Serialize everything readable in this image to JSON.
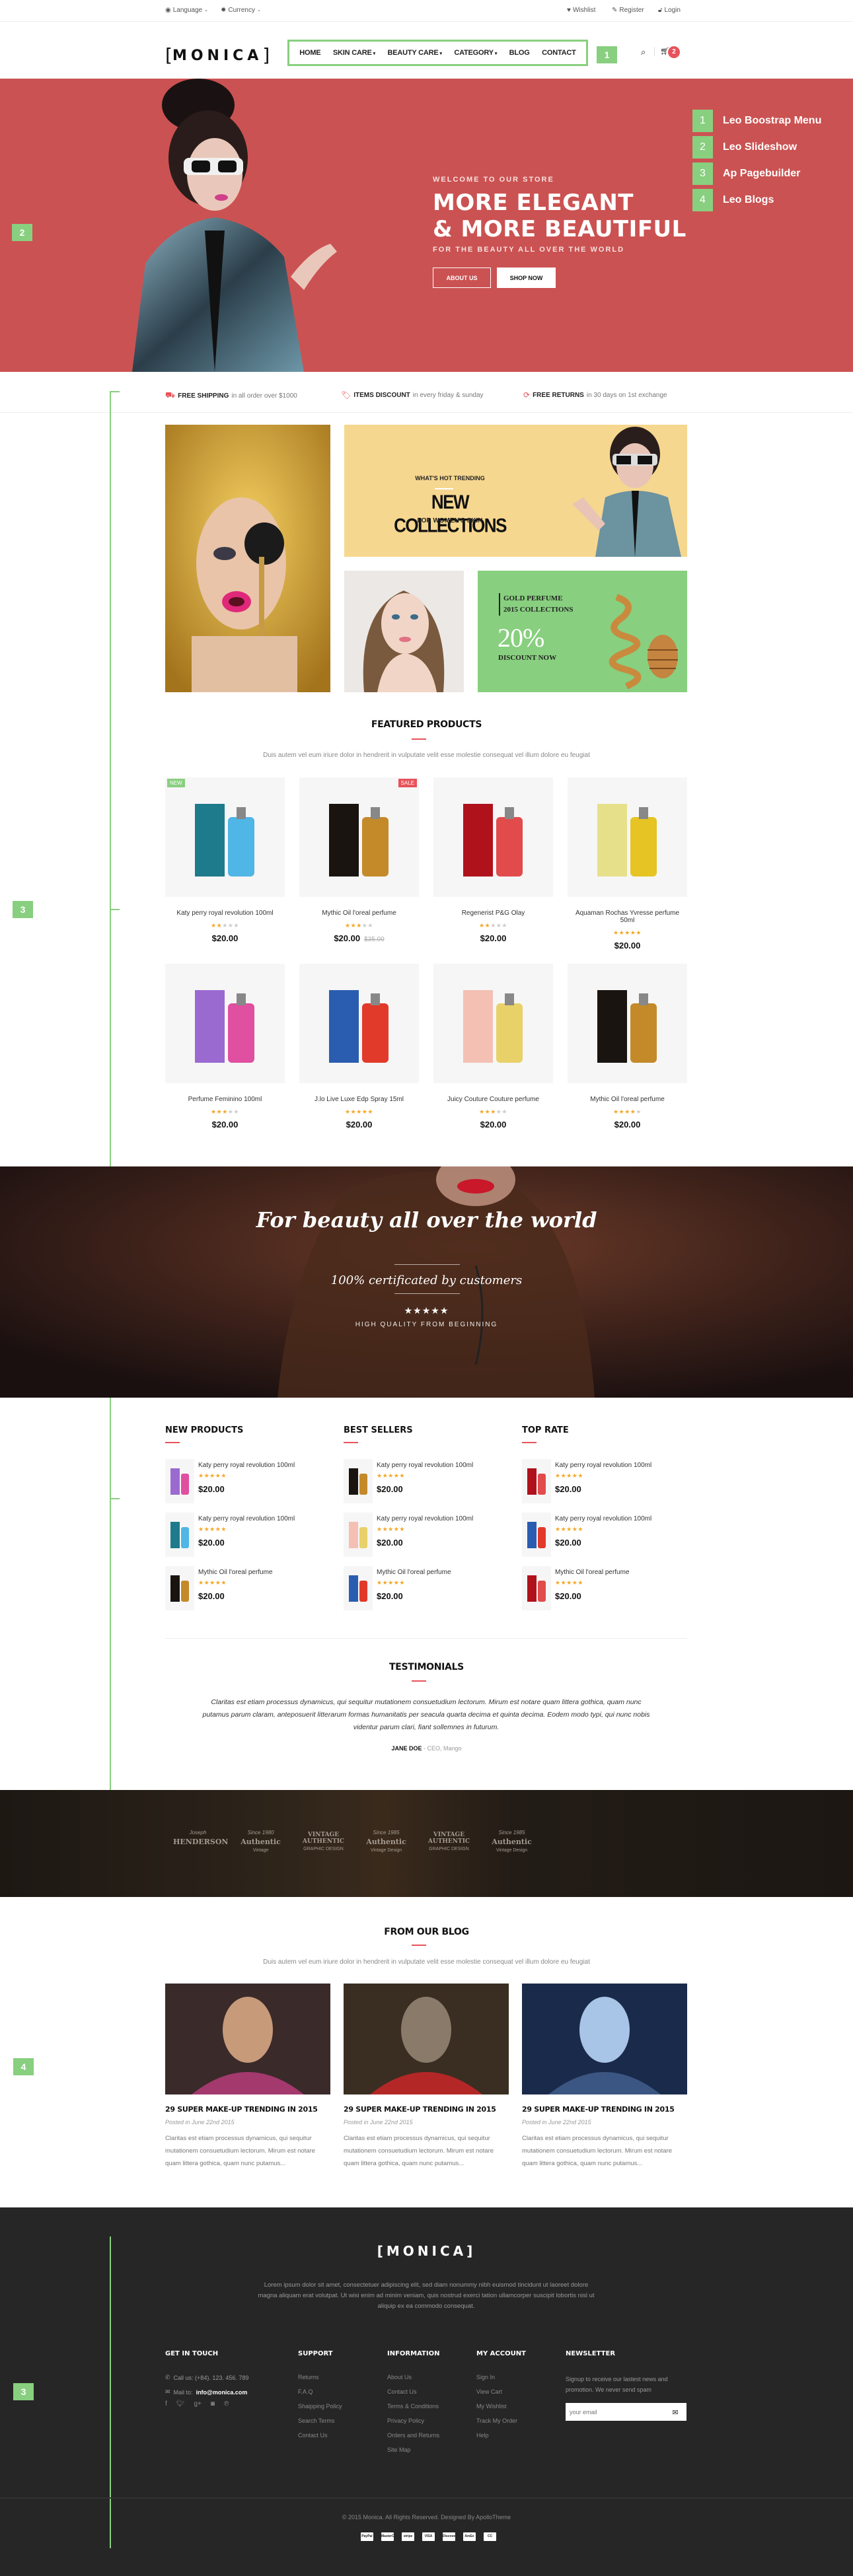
{
  "topbar": {
    "language": "Language",
    "currency": "Currency",
    "wishlist": "Wishlist",
    "register": "Register",
    "login": "Login"
  },
  "header": {
    "logo": "MONICA",
    "nav": [
      "HOME",
      "SKIN CARE",
      "BEAUTY CARE",
      "CATEGORY",
      "BLOG",
      "CONTACT"
    ],
    "nav_dropdown": [
      false,
      true,
      true,
      true,
      false,
      false
    ],
    "cart_count": "2"
  },
  "annotations": {
    "markers": [
      "1",
      "2",
      "3",
      "4",
      "3"
    ],
    "legend": [
      {
        "num": "1",
        "label": "Leo Boostrap Menu"
      },
      {
        "num": "2",
        "label": "Leo Slideshow"
      },
      {
        "num": "3",
        "label": "Ap Pagebuilder"
      },
      {
        "num": "4",
        "label": "Leo Blogs"
      }
    ],
    "color": "#88cf7f"
  },
  "hero": {
    "kicker": "WELCOME TO OUR STORE",
    "title_line1": "MORE ELEGANT",
    "title_line2": "& MORE BEAUTIFUL",
    "subtitle": "FOR THE BEAUTY ALL OVER THE WORLD",
    "btn_about": "ABOUT US",
    "btn_shop": "SHOP NOW",
    "bg_color": "#cb5252"
  },
  "services": [
    {
      "bold": "FREE SHIPPING",
      "text": " in all order over $1000",
      "icon": "truck-icon"
    },
    {
      "bold": "ITEMS DISCOUNT",
      "text": " in every friday & sunday",
      "icon": "tag-icon"
    },
    {
      "bold": "FREE RETURNS",
      "text": " in 30 days on 1st exchange",
      "icon": "refresh-icon"
    }
  ],
  "banners": {
    "trending_kicker": "WHAT'S HOT TRENDING",
    "trending_title": "NEW COLLECTIONS",
    "trending_sub": "FOR WOMEN'S SKIN",
    "gold_line1": "GOLD PERFUME",
    "gold_line2": "2015 COLLECTIONS",
    "gold_percent": "20%",
    "gold_cta": "DISCOUNT NOW"
  },
  "featured": {
    "title": "FEATURED PRODUCTS",
    "description": "Duis autem vel eum iriure dolor in hendrerit in vulputate velit esse molestie consequat vel illum dolore eu feugiat",
    "products": [
      {
        "name": "Katy perry royal revolution 100ml",
        "rating": 2,
        "price": "$20.00",
        "old_price": "",
        "tag": "NEW"
      },
      {
        "name": "Mythic Oil l'oreal perfume",
        "rating": 3,
        "price": "$20.00",
        "old_price": "$35.00",
        "tag": "SALE"
      },
      {
        "name": "Regenerist P&G Olay",
        "rating": 2,
        "price": "$20.00",
        "old_price": "",
        "tag": ""
      },
      {
        "name": "Aquaman Rochas Yvresse perfume 50ml",
        "rating": 5,
        "price": "$20.00",
        "old_price": "",
        "tag": ""
      },
      {
        "name": "Perfume Feminino 100ml",
        "rating": 3,
        "price": "$20.00",
        "old_price": "",
        "tag": ""
      },
      {
        "name": "J.lo Live Luxe Edp Spray 15ml",
        "rating": 5,
        "price": "$20.00",
        "old_price": "",
        "tag": ""
      },
      {
        "name": "Juicy Couture Couture perfume",
        "rating": 3,
        "price": "$20.00",
        "old_price": "",
        "tag": ""
      },
      {
        "name": "Mythic Oil l'oreal perfume",
        "rating": 4,
        "price": "$20.00",
        "old_price": "",
        "tag": ""
      }
    ]
  },
  "parallax": {
    "title": "For beauty all over the world",
    "subtitle": "100% certificated by customers",
    "stars": "★★★★★",
    "tagline": "HIGH QUALITY FROM BEGINNING"
  },
  "lists": [
    {
      "title": "NEW PRODUCTS",
      "items": [
        {
          "name": "Katy perry royal revolution 100ml",
          "rating": 5,
          "price": "$20.00"
        },
        {
          "name": "Katy perry royal revolution 100ml",
          "rating": 5,
          "price": "$20.00"
        },
        {
          "name": "Mythic Oil l'oreal perfume",
          "rating": 5,
          "price": "$20.00"
        }
      ]
    },
    {
      "title": "BEST SELLERS",
      "items": [
        {
          "name": "Katy perry royal revolution 100ml",
          "rating": 5,
          "price": "$20.00"
        },
        {
          "name": "Katy perry royal revolution 100ml",
          "rating": 5,
          "price": "$20.00"
        },
        {
          "name": "Mythic Oil l'oreal perfume",
          "rating": 5,
          "price": "$20.00"
        }
      ]
    },
    {
      "title": "TOP RATE",
      "items": [
        {
          "name": "Katy perry royal revolution 100ml",
          "rating": 5,
          "price": "$20.00"
        },
        {
          "name": "Katy perry royal revolution 100ml",
          "rating": 5,
          "price": "$20.00"
        },
        {
          "name": "Mythic Oil l'oreal perfume",
          "rating": 5,
          "price": "$20.00"
        }
      ]
    }
  ],
  "testimonials": {
    "title": "TESTIMONIALS",
    "text": "Claritas est etiam processus dynamicus, qui sequitur mutationem consuetudium lectorum. Mirum est notare quam littera gothica, quam nunc putamus parum claram, anteposuerit litterarum formas humanitatis per seacula quarta decima et quinta decima. Eodem modo typi, qui nunc nobis videntur parum clari, fiant sollemnes in futurum.",
    "author": "JANE DOE",
    "role": " - CEO, Mango"
  },
  "brands": [
    {
      "top": "Joseph",
      "main": "HENDERSON",
      "bottom": ""
    },
    {
      "top": "Since 1980",
      "main": "Authentic",
      "bottom": "Vintage"
    },
    {
      "top": "",
      "main": "VINTAGE AUTHENTIC",
      "bottom": "GRAPHIC DESIGN"
    },
    {
      "top": "Since 1985",
      "main": "Authentic",
      "bottom": "Vintage Design"
    },
    {
      "top": "",
      "main": "VINTAGE AUTHENTIC",
      "bottom": "GRAPHIC DESIGN"
    },
    {
      "top": "Since 1985",
      "main": "Authentic",
      "bottom": "Vintage Design"
    }
  ],
  "blog": {
    "title": "FROM OUR BLOG",
    "description": "Duis autem vel eum iriure dolor in hendrerit in vulputate velit esse molestie consequat vel illum dolore eu feugiat",
    "posts": [
      {
        "title": "29 SUPER MAKE-UP TRENDING IN 2015",
        "date": "Posted in June 22nd 2015",
        "excerpt": "Claritas est etiam processus dynamicus, qui sequitur mutationem consuetudium lectorum. Mirum est notare quam littera gothica, quam nunc putamus..."
      },
      {
        "title": "29 SUPER MAKE-UP TRENDING IN 2015",
        "date": "Posted in June 22nd 2015",
        "excerpt": "Claritas est etiam processus dynamicus, qui sequitur mutationem consuetudium lectorum. Mirum est notare quam littera gothica, quam nunc putamus..."
      },
      {
        "title": "29 SUPER MAKE-UP TRENDING IN 2015",
        "date": "Posted in June 22nd 2015",
        "excerpt": "Claritas est etiam processus dynamicus, qui sequitur mutationem consuetudium lectorum. Mirum est notare quam littera gothica, quam nunc putamus..."
      }
    ]
  },
  "footer": {
    "logo": "MONICA",
    "about": "Lorem ipsum dolor sit amet, consectetuer adipiscing elit, sed diam nonummy nibh euismod tincidunt ut laoreet dolore magna aliquam erat volutpat. Ut wisi enim ad minim veniam, quis nostrud exerci tation ullamcorper suscipit lobortis nisl ut aliquip ex ea commodo consequat.",
    "contact_title": "GET IN TOUCH",
    "phone": "Call us: (+84). 123. 456. 789",
    "mail_label": "Mail to: ",
    "mail": "info@monica.com",
    "social": [
      "facebook-icon",
      "twitter-icon",
      "google-plus-icon",
      "instagram-icon",
      "pinterest-icon"
    ],
    "columns": [
      {
        "title": "SUPPORT",
        "links": [
          "Returns",
          "F.A.Q",
          "Shaipping Policy",
          "Search Terms",
          "Contact Us"
        ]
      },
      {
        "title": "INFORMATION",
        "links": [
          "About Us",
          "Contact Us",
          "Terms & Conditions",
          "Privacy Policy",
          "Orders and Returns",
          "Site Map"
        ]
      },
      {
        "title": "MY ACCOUNT",
        "links": [
          "Sign In",
          "View Cart",
          "My Wishlist",
          "Track My Order",
          "Help"
        ]
      }
    ],
    "newsletter_title": "NEWSLETTER",
    "newsletter_text": "Signup to receive our lastest news and promotion. We never send spam",
    "newsletter_placeholder": "your email",
    "copyright": "© 2015 Monica. All Rights Reserved. Designed By ApolloTheme",
    "payments": [
      "PayPal",
      "MasterCard",
      "stripe",
      "VISA",
      "Discover",
      "AmEx",
      "CC"
    ]
  }
}
